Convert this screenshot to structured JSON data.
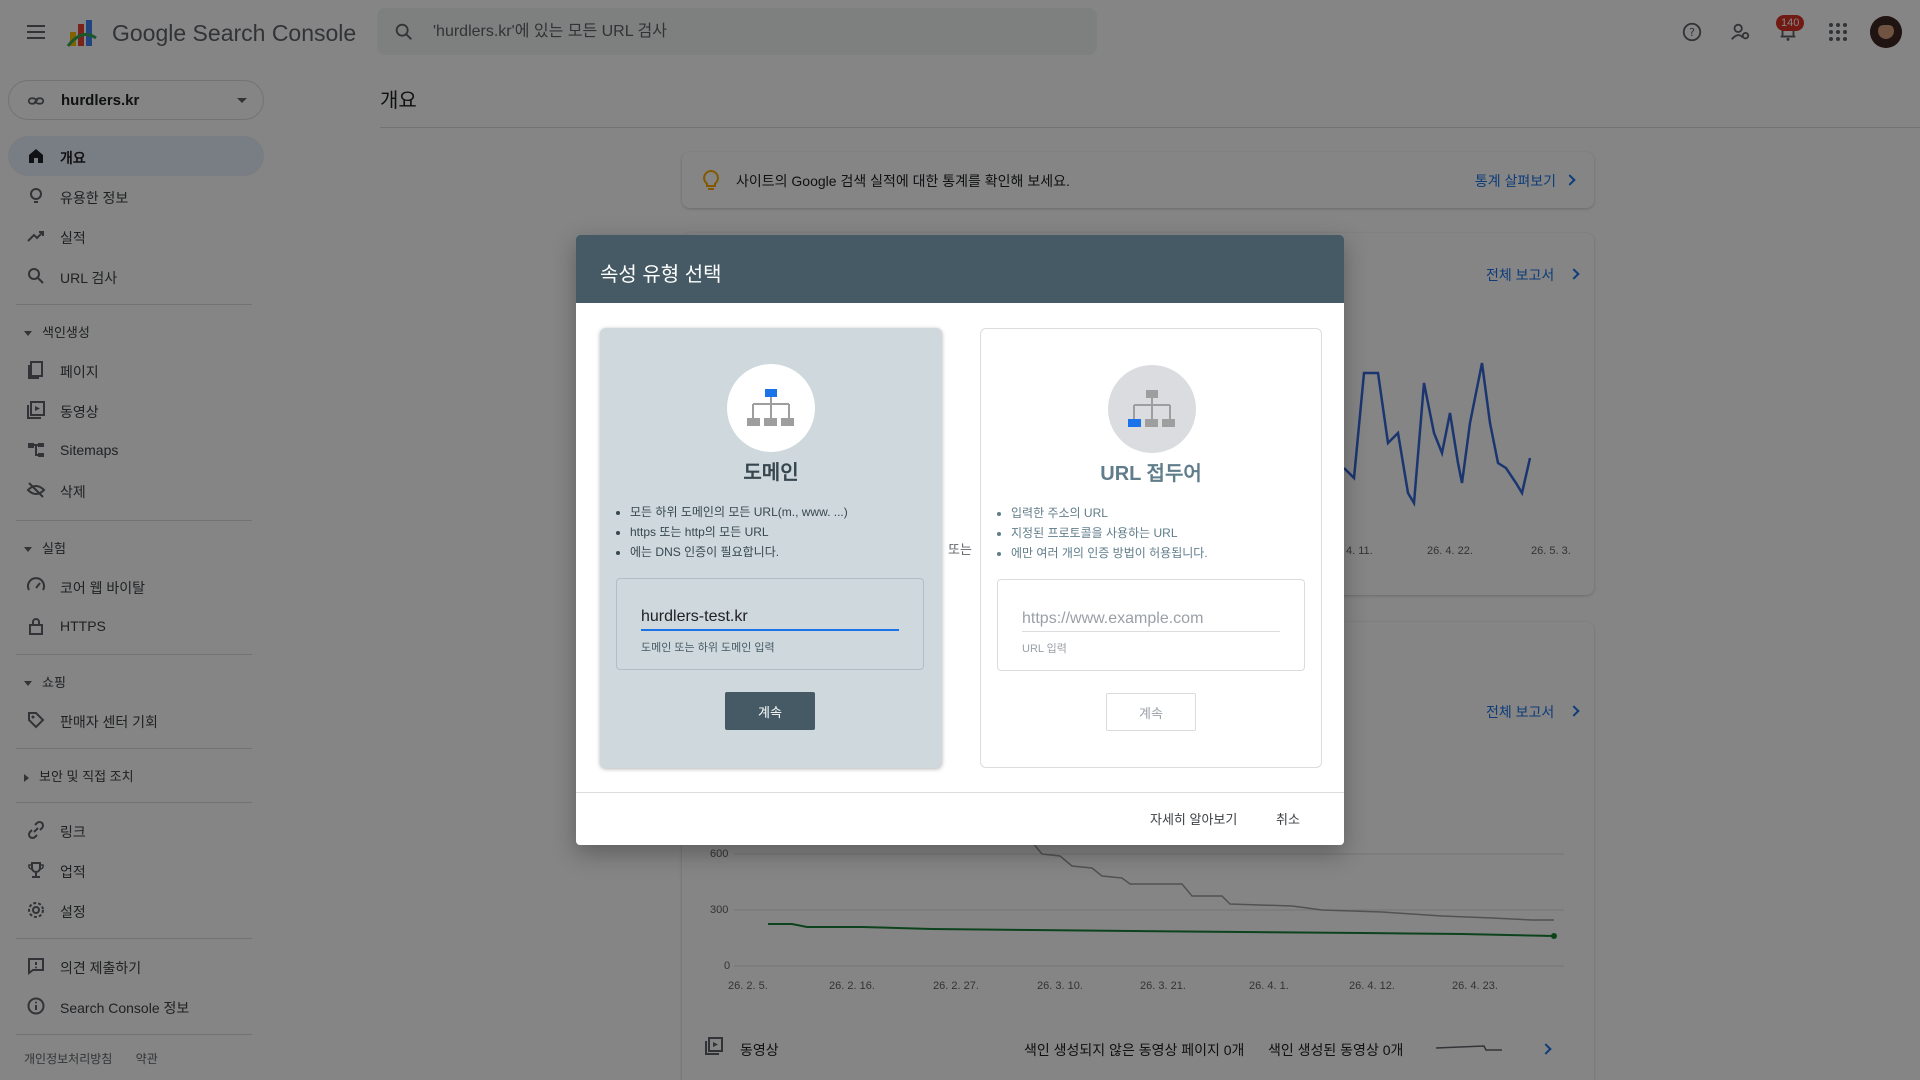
{
  "header": {
    "app_title": "Google Search Console",
    "search_placeholder": "'hurdlers.kr'에 있는 모든 URL 검사",
    "notification_count": "140"
  },
  "sidebar": {
    "property": "hurdlers.kr",
    "items": [
      {
        "label": "개요"
      },
      {
        "label": "유용한 정보"
      },
      {
        "label": "실적"
      },
      {
        "label": "URL 검사"
      }
    ],
    "sections": {
      "indexing": "색인생성",
      "experience": "실험",
      "shopping": "쇼핑",
      "security": "보안 및 직접 조치"
    },
    "indexing_items": [
      {
        "label": "페이지"
      },
      {
        "label": "동영상"
      },
      {
        "label": "Sitemaps"
      },
      {
        "label": "삭제"
      }
    ],
    "experience_items": [
      {
        "label": "코어 웹 바이탈"
      },
      {
        "label": "HTTPS"
      }
    ],
    "shopping_items": [
      {
        "label": "판매자 센터 기회"
      }
    ],
    "bottom_items": [
      {
        "label": "링크"
      },
      {
        "label": "업적"
      },
      {
        "label": "설정"
      }
    ],
    "extra_items": [
      {
        "label": "의견 제출하기"
      },
      {
        "label": "Search Console 정보"
      }
    ],
    "footer": {
      "privacy": "개인정보처리방침",
      "terms": "약관"
    }
  },
  "main": {
    "page_title": "개요",
    "tip_text": "사이트의 Google 검색 실적에 대한 통계를 확인해 보세요.",
    "tip_link": "통계 살펴보기",
    "full_report_1": "전체 보고서",
    "full_report_2": "전체 보고서",
    "chart1_xticks": [
      "4. 11.",
      "26. 4. 22.",
      "26. 5. 3."
    ],
    "chart2_yticks": [
      "600",
      "300",
      "0"
    ],
    "chart2_xticks": [
      "26. 2. 5.",
      "26. 2. 16.",
      "26. 2. 27.",
      "26. 3. 10.",
      "26. 3. 21.",
      "26. 4. 1.",
      "26. 4. 12.",
      "26. 4. 23."
    ],
    "video_label": "동영상",
    "video_not_indexed": "색인 생성되지 않은 동영상 페이지 0개",
    "video_indexed": "색인 생성된 동영상 0개"
  },
  "dialog": {
    "title": "속성 유형 선택",
    "or_label": "또는",
    "domain": {
      "title": "도메인",
      "bullets": [
        "모든 하위 도메인의 모든 URL(m., www. ...)",
        "https 또는 http의 모든 URL",
        "에는 DNS 인증이 필요합니다."
      ],
      "input_value": "hurdlers-test.kr",
      "help": "도메인 또는 하위 도메인 입력",
      "button": "계속"
    },
    "url_prefix": {
      "title": "URL 접두어",
      "bullets": [
        "입력한 주소의 URL",
        "지정된 프로토콜을 사용하는 URL",
        "에만 여러 개의 인증 방법이 허용됩니다."
      ],
      "input_placeholder": "https://www.example.com",
      "help": "URL 입력",
      "button": "계속"
    },
    "learn_more": "자세히 알아보기",
    "cancel": "취소"
  },
  "colors": {
    "accent": "#1a73e8",
    "dialog_header": "#455a64",
    "domain_card": "#cfd8dc",
    "badge": "#d93025"
  }
}
